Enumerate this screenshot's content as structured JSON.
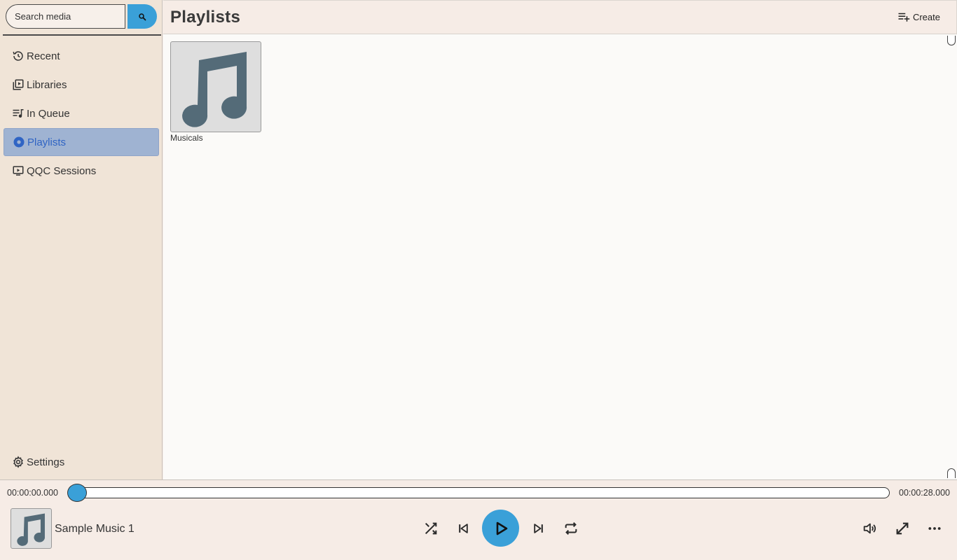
{
  "search": {
    "placeholder": "Search media"
  },
  "nav": {
    "items": [
      {
        "label": "Recent",
        "icon": "history-icon"
      },
      {
        "label": "Libraries",
        "icon": "library-icon"
      },
      {
        "label": "In Queue",
        "icon": "queue-music-icon"
      },
      {
        "label": "Playlists",
        "icon": "album-icon",
        "active": true
      },
      {
        "label": "QQC Sessions",
        "icon": "slideshow-icon"
      }
    ],
    "settings_label": "Settings"
  },
  "header": {
    "title": "Playlists",
    "create_label": "Create"
  },
  "playlists": [
    {
      "label": "Musicals",
      "icon": "music-note-icon"
    }
  ],
  "player": {
    "current_time": "00:00:00.000",
    "total_time": "00:00:28.000",
    "progress_fraction": 0,
    "track_title": "Sample Music 1"
  },
  "colors": {
    "accent": "#3aa0d8",
    "sidebar_bg": "#f0e4d7",
    "active_item": "#9fb3d2",
    "active_text": "#2f64c4",
    "content_bg": "#fbfaf8"
  }
}
